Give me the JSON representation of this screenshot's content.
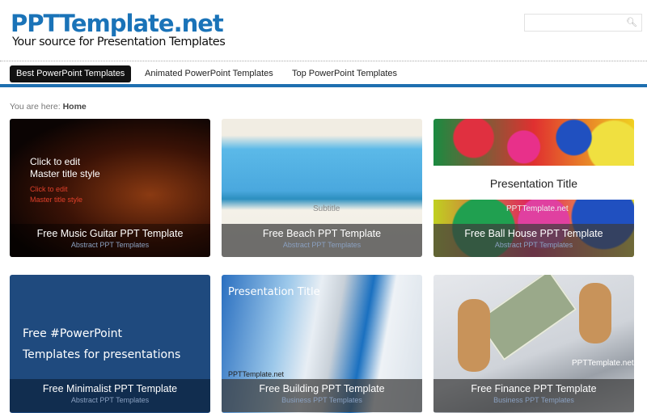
{
  "header": {
    "logo": "PPTTemplate.net",
    "tagline": "Your source for Presentation Templates",
    "search_placeholder": ""
  },
  "nav": {
    "items": [
      {
        "label": "Best PowerPoint Templates",
        "active": true
      },
      {
        "label": "Animated PowerPoint Templates"
      },
      {
        "label": "Top PowerPoint Templates"
      }
    ]
  },
  "breadcrumb": {
    "prefix": "You are here:",
    "current": "Home"
  },
  "accent": "#1e6fb0",
  "cards": [
    {
      "title": "Free Music Guitar PPT Template",
      "category": "Abstract PPT Templates",
      "slide": {
        "l1": "Click to edit",
        "l2": "Master title style",
        "l3": "Click to edit",
        "l4": "Master title style"
      }
    },
    {
      "title": "Free Beach PPT Template",
      "category": "Abstract PPT Templates",
      "slide": {
        "sub": "Subtitle"
      }
    },
    {
      "title": "Free Ball House PPT Template",
      "category": "Abstract PPT Templates",
      "slide": {
        "title": "Presentation Title",
        "brand": "PPTTemplate.net"
      }
    },
    {
      "title": "Free Minimalist PPT Template",
      "category": "Abstract PPT Templates",
      "slide": {
        "l1": "Free #PowerPoint",
        "l2": "Templates for presentations"
      }
    },
    {
      "title": "Free Building PPT Template",
      "category": "Business PPT Templates",
      "slide": {
        "title": "Presentation Title",
        "brand": "PPTTemplate.net"
      }
    },
    {
      "title": "Free Finance PPT Template",
      "category": "Business PPT Templates",
      "slide": {
        "brand": "PPTTemplate.net"
      }
    }
  ]
}
